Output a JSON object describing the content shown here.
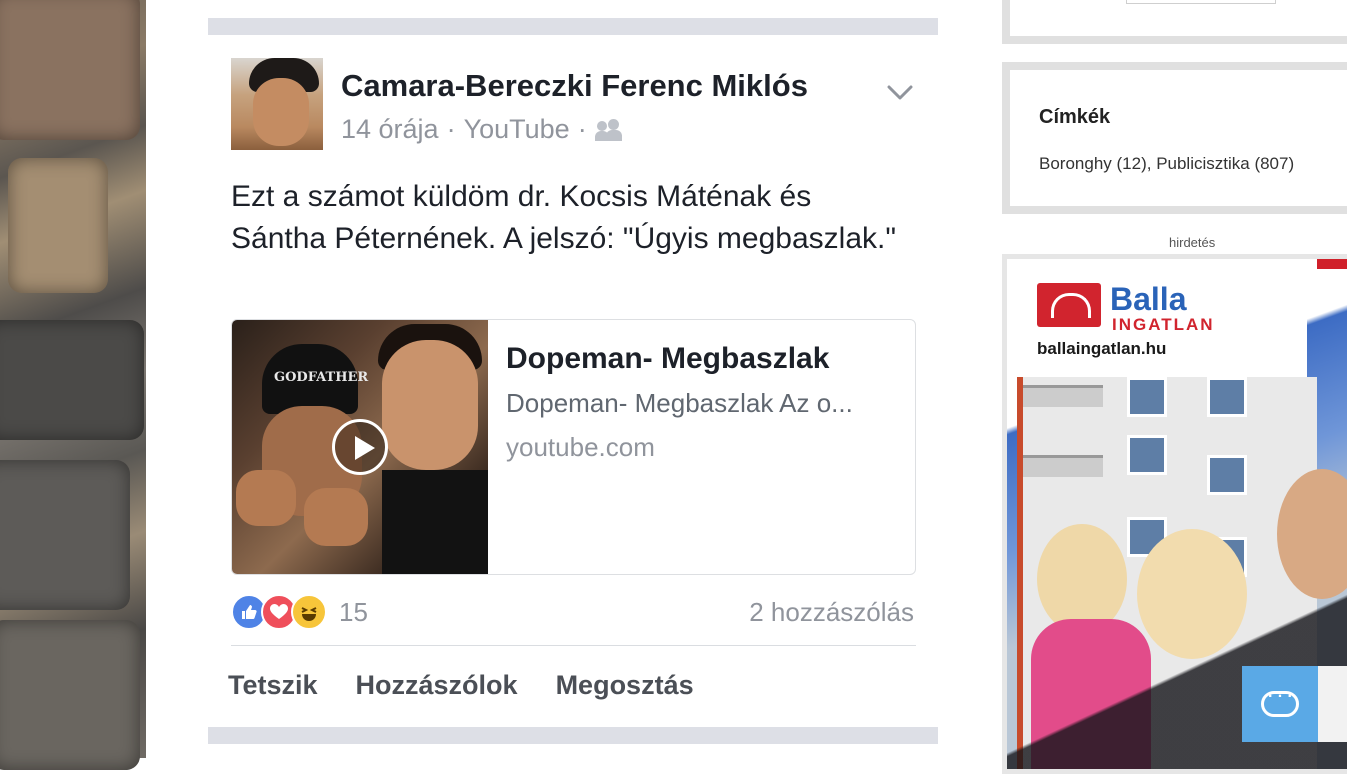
{
  "post": {
    "author": "Camara-Bereczki Ferenc Miklós",
    "time": "14 órája",
    "separator": "·",
    "source": "YouTube",
    "audience_icon": "friends-icon",
    "text": "Ezt a számot küldöm dr. Kocsis Máténak és Sántha Péternének. A jelszó: \"Úgyis megbaszlak.\"",
    "link": {
      "title": "Dopeman- Megbaszlak",
      "description": "Dopeman- Megbaszlak Az o...",
      "domain": "youtube.com",
      "thumbnail_text": "GODFATHER"
    },
    "reactions": {
      "types": [
        "like",
        "love",
        "haha"
      ],
      "count": "15"
    },
    "comments": "2 hozzászólás",
    "actions": {
      "like": "Tetszik",
      "comment": "Hozzászólok",
      "share": "Megosztás"
    }
  },
  "sidebar": {
    "tags": {
      "title": "Címkék",
      "items": [
        "Boronghy (12)",
        "Publicisztika (807)"
      ],
      "separator": ", "
    },
    "ad_label": "hirdetés",
    "ad": {
      "brand": "Balla",
      "brand_sub": "INGATLAN",
      "site": "ballaingatlan.hu"
    }
  },
  "colors": {
    "accent_blue": "#4f83e6",
    "love_red": "#ef4f5b",
    "haha_yellow": "#f7c53a",
    "brand_red": "#d1242e",
    "brand_blue": "#2a63b8",
    "chat_blue": "#5aa9e6"
  }
}
